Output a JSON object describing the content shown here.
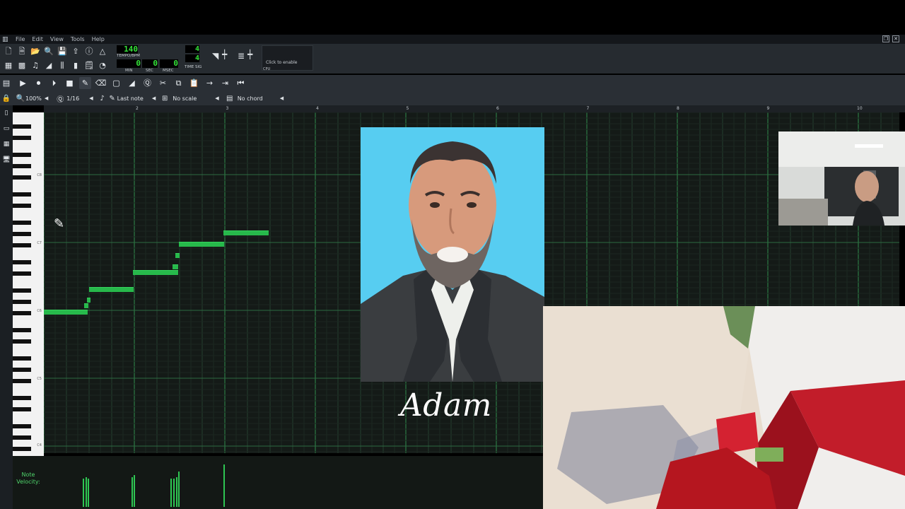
{
  "menu": {
    "items": [
      "File",
      "Edit",
      "View",
      "Tools",
      "Help"
    ]
  },
  "transport": {
    "tempo": "140",
    "tempo_label": "TEMPO/BPM",
    "min": "0",
    "min_label": "MIN",
    "sec": "0",
    "sec_label": "SEC",
    "msec": "0",
    "msec_label": "MSEC",
    "timesig_num": "4",
    "timesig_den": "4",
    "timesig_label": "TIME SIG",
    "cpu_hint": "Click to enable",
    "cpu_label": "CPU"
  },
  "piano_roll": {
    "zoom": "100%",
    "quantize": "1/16",
    "note_length": "Last note",
    "scale": "No scale",
    "chord": "No chord",
    "bar_numbers": [
      "2",
      "3",
      "4",
      "5",
      "6",
      "7",
      "8",
      "9",
      "10"
    ],
    "key_labels": [
      "C8",
      "C7",
      "C6",
      "C5",
      "C4"
    ],
    "velocity_label_1": "Note",
    "velocity_label_2": "Velocity:"
  },
  "caption": {
    "name": "Adam"
  },
  "colors": {
    "note_green": "#27b94b",
    "lcd_green": "#35e33a",
    "sky_blue": "#4fcdf0"
  }
}
